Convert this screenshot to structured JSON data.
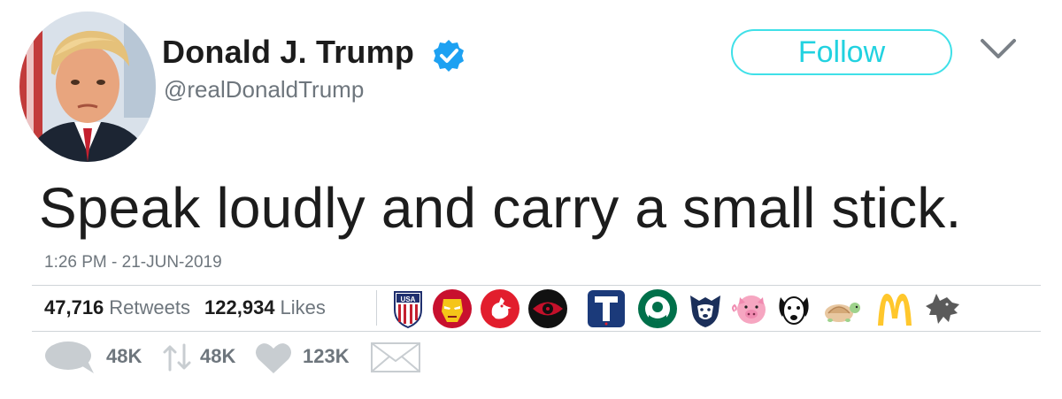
{
  "author": {
    "name": "Donald J. Trump",
    "handle": "@realDonaldTrump",
    "verified": true
  },
  "header": {
    "follow_label": "Follow",
    "menu_icon": "chevron-down-icon"
  },
  "tweet": {
    "text": "Speak loudly and carry a small stick.",
    "timestamp": "1:26 PM - 21-JUN-2019"
  },
  "stats": {
    "retweets_count": "47,716",
    "retweets_label": "Retweets",
    "likes_count": "122,934",
    "likes_label": "Likes"
  },
  "likers": [
    {
      "icon": "usa-shield-icon"
    },
    {
      "icon": "iron-man-icon"
    },
    {
      "icon": "rooster-icon"
    },
    {
      "icon": "red-eye-icon"
    },
    {
      "icon": "letter-t-icon"
    },
    {
      "icon": "starbucks-icon"
    },
    {
      "icon": "husky-icon"
    },
    {
      "icon": "pig-icon"
    },
    {
      "icon": "dog-icon"
    },
    {
      "icon": "turtle-icon"
    },
    {
      "icon": "mcdonalds-icon"
    },
    {
      "icon": "direwolf-icon"
    }
  ],
  "actions": {
    "reply_count": "48K",
    "retweet_count": "48K",
    "like_count": "123K"
  },
  "colors": {
    "follow_accent": "#22d2e0",
    "verified_blue": "#1da1f2",
    "text_primary": "#1c1c1c",
    "text_secondary": "#6e767d",
    "icon_gray": "#c8cdd1"
  }
}
